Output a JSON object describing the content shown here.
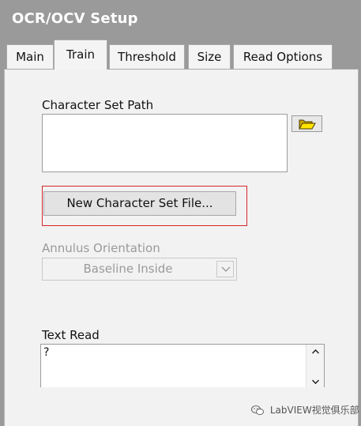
{
  "window": {
    "title": "OCR/OCV Setup"
  },
  "tabs": [
    {
      "label": "Main",
      "active": false
    },
    {
      "label": "Train",
      "active": true
    },
    {
      "label": "Threshold",
      "active": false
    },
    {
      "label": "Size",
      "active": false
    },
    {
      "label": "Read Options",
      "active": false
    }
  ],
  "train": {
    "character_set_path_label": "Character Set Path",
    "character_set_path_value": "",
    "browse_icon": "folder-open-icon",
    "new_file_button_label": "New Character Set File...",
    "annulus_orientation_label": "Annulus Orientation",
    "annulus_orientation_value": "Baseline Inside",
    "text_read_label": "Text Read",
    "text_read_value": "?"
  },
  "highlight_color": "#d9252b",
  "watermark": {
    "text": "LabVIEW视觉俱乐部",
    "icon": "wechat-icon"
  }
}
